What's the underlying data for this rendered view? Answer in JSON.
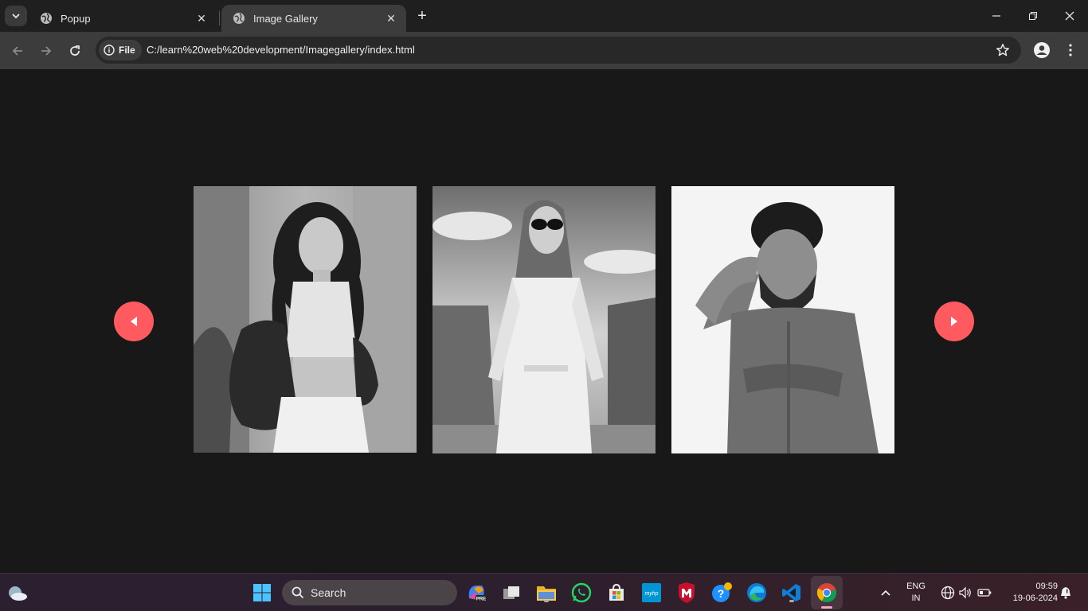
{
  "browser": {
    "tabs": [
      {
        "title": "Popup",
        "active": false
      },
      {
        "title": "Image Gallery",
        "active": true
      }
    ],
    "address": {
      "scheme_chip": "File",
      "url": "C:/learn%20web%20development/Imagegallery/index.html"
    },
    "icons": {
      "back": "arrow-left-icon",
      "forward": "arrow-right-icon",
      "reload": "reload-icon",
      "bookmark": "star-icon",
      "profile": "profile-icon",
      "menu": "kebab-menu-icon"
    }
  },
  "gallery": {
    "accent_color": "#ff5a5f",
    "prev_icon": "triangle-left-icon",
    "next_icon": "triangle-right-icon",
    "images": [
      {
        "subject": "woman-curly-hair-leather-jacket"
      },
      {
        "subject": "woman-sunglasses-white-shirt-dress"
      },
      {
        "subject": "man-curly-hair-beard-denim-shirt"
      }
    ]
  },
  "taskbar": {
    "search_label": "Search",
    "language": {
      "line1": "ENG",
      "line2": "IN"
    },
    "clock": {
      "time": "09:59",
      "date": "19-06-2024"
    },
    "pinned_apps": [
      "copilot-icon",
      "task-view-icon",
      "file-explorer-icon",
      "whatsapp-icon",
      "microsoft-store-icon",
      "myhp-icon",
      "mcafee-icon",
      "help-icon",
      "edge-icon",
      "vscode-icon",
      "chrome-icon"
    ],
    "myhp_label": "myhp",
    "copilot_badge": "PRE"
  }
}
